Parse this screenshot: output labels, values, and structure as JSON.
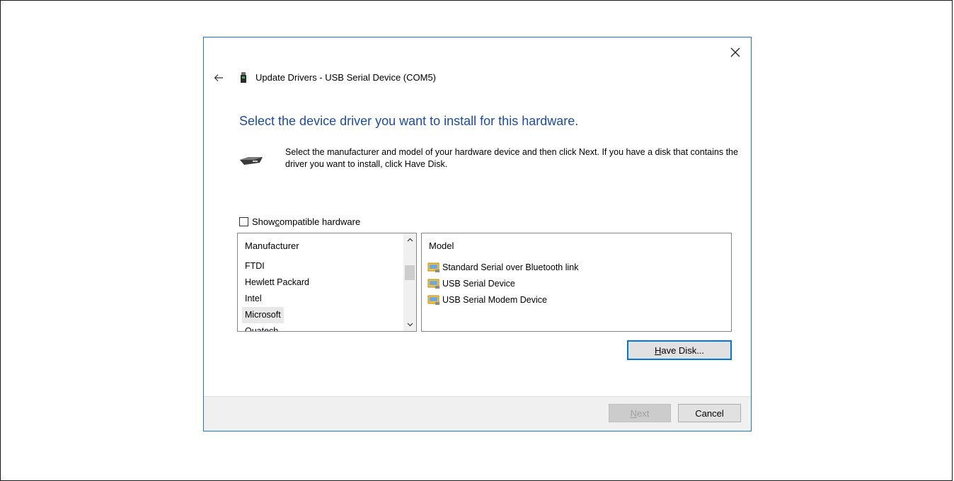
{
  "dialog": {
    "title": "Update Drivers - USB Serial Device (COM5)",
    "heading": "Select the device driver you want to install for this hardware.",
    "instructions": "Select the manufacturer and model of your hardware device and then click Next. If you have a disk that contains the driver you want to install, click Have Disk.",
    "compat_checkbox": {
      "label_pre": "Show ",
      "label_underlined": "c",
      "label_post": "ompatible hardware",
      "checked": false
    },
    "manufacturer_list": {
      "header": "Manufacturer",
      "items": [
        "FTDI",
        "Hewlett Packard",
        "Intel",
        "Microsoft",
        "Quatech"
      ],
      "selected": "Microsoft"
    },
    "model_list": {
      "header": "Model",
      "items": [
        "Standard Serial over Bluetooth link",
        "USB Serial Device",
        "USB Serial Modem Device"
      ]
    },
    "have_disk_button": {
      "underlined": "H",
      "rest": "ave Disk..."
    },
    "next_button": {
      "underlined": "N",
      "rest": "ext",
      "enabled": false
    },
    "cancel_button": "Cancel"
  },
  "icons": {
    "close": "close-icon",
    "back": "back-arrow-icon",
    "title": "usb-device-icon",
    "hardware": "hardware-device-icon",
    "model_item": "driver-icon"
  },
  "colors": {
    "heading": "#1c4ba8",
    "dialog_border": "#1979ca",
    "default_button_border": "#0078d7"
  }
}
